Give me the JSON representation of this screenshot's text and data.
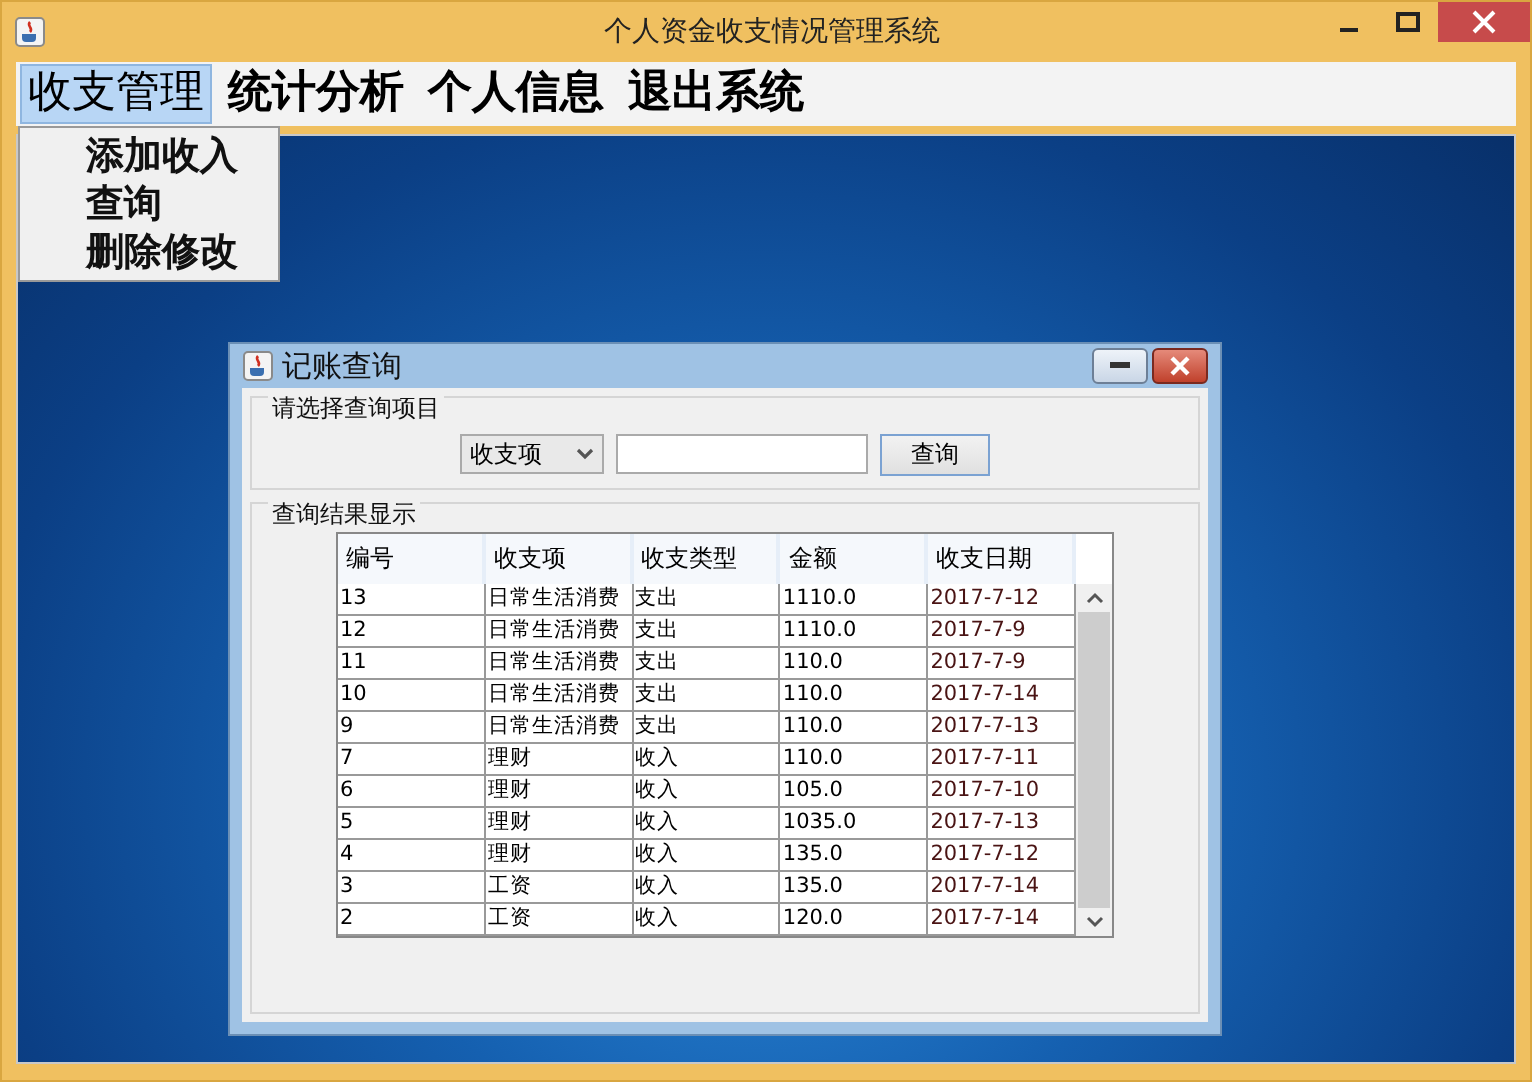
{
  "window": {
    "title": "个人资金收支情况管理系统"
  },
  "menu_bar": [
    {
      "label": "收支管理",
      "selected": true
    },
    {
      "label": "统计分析",
      "selected": false
    },
    {
      "label": "个人信息",
      "selected": false
    },
    {
      "label": "退出系统",
      "selected": false
    }
  ],
  "open_menu": {
    "items": [
      "添加收入",
      "查询",
      "删除修改"
    ]
  },
  "dialog": {
    "title": "记账查询",
    "query_group": {
      "title": "请选择查询项目",
      "dropdown": {
        "value": "收支项"
      },
      "button": "查询"
    },
    "results_group": {
      "title": "查询结果显示",
      "table": {
        "columns": [
          "编号",
          "收支项",
          "收支类型",
          "金额",
          "收支日期"
        ],
        "rows": [
          [
            "13",
            "日常生活消费",
            "支出",
            "1110.0",
            "2017-7-12"
          ],
          [
            "12",
            "日常生活消费",
            "支出",
            "1110.0",
            "2017-7-9"
          ],
          [
            "11",
            "日常生活消费",
            "支出",
            "110.0",
            "2017-7-9"
          ],
          [
            "10",
            "日常生活消费",
            "支出",
            "110.0",
            "2017-7-14"
          ],
          [
            "9",
            "日常生活消费",
            "支出",
            "110.0",
            "2017-7-13"
          ],
          [
            "7",
            "理财",
            "收入",
            "110.0",
            "2017-7-11"
          ],
          [
            "6",
            "理财",
            "收入",
            "105.0",
            "2017-7-10"
          ],
          [
            "5",
            "理财",
            "收入",
            "1035.0",
            "2017-7-13"
          ],
          [
            "4",
            "理财",
            "收入",
            "135.0",
            "2017-7-12"
          ],
          [
            "3",
            "工资",
            "收入",
            "135.0",
            "2017-7-14"
          ],
          [
            "2",
            "工资",
            "收入",
            "120.0",
            "2017-7-14"
          ]
        ]
      }
    }
  }
}
